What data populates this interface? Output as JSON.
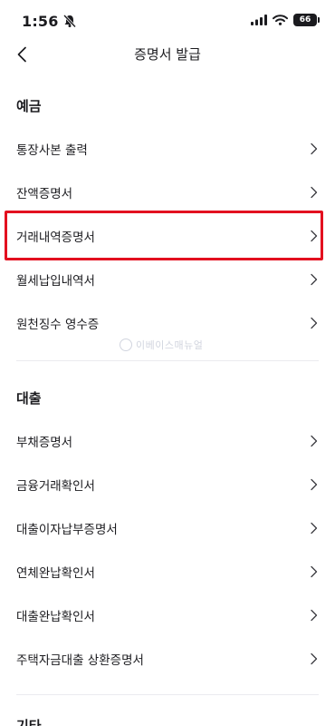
{
  "status_bar": {
    "time": "1:56",
    "battery": "66",
    "icons": [
      "bell-slash-icon",
      "signal-icon",
      "wifi-icon",
      "battery-icon"
    ]
  },
  "nav": {
    "title": "증명서 발급",
    "back_icon": "chevron-left-icon"
  },
  "sections": {
    "deposit": {
      "title": "예금",
      "items": [
        "통장사본 출력",
        "잔액증명서",
        "거래내역증명서",
        "월세납입내역서",
        "원천징수 영수증"
      ]
    },
    "loan": {
      "title": "대출",
      "items": [
        "부채증명서",
        "금융거래확인서",
        "대출이자납부증명서",
        "연체완납확인서",
        "대출완납확인서",
        "주택자금대출 상환증명서"
      ]
    },
    "next": {
      "title": "기타"
    }
  },
  "highlighted_item": "거래내역증명서",
  "highlight_color": "#e3101f",
  "watermark": "이베이스매뉴얼"
}
